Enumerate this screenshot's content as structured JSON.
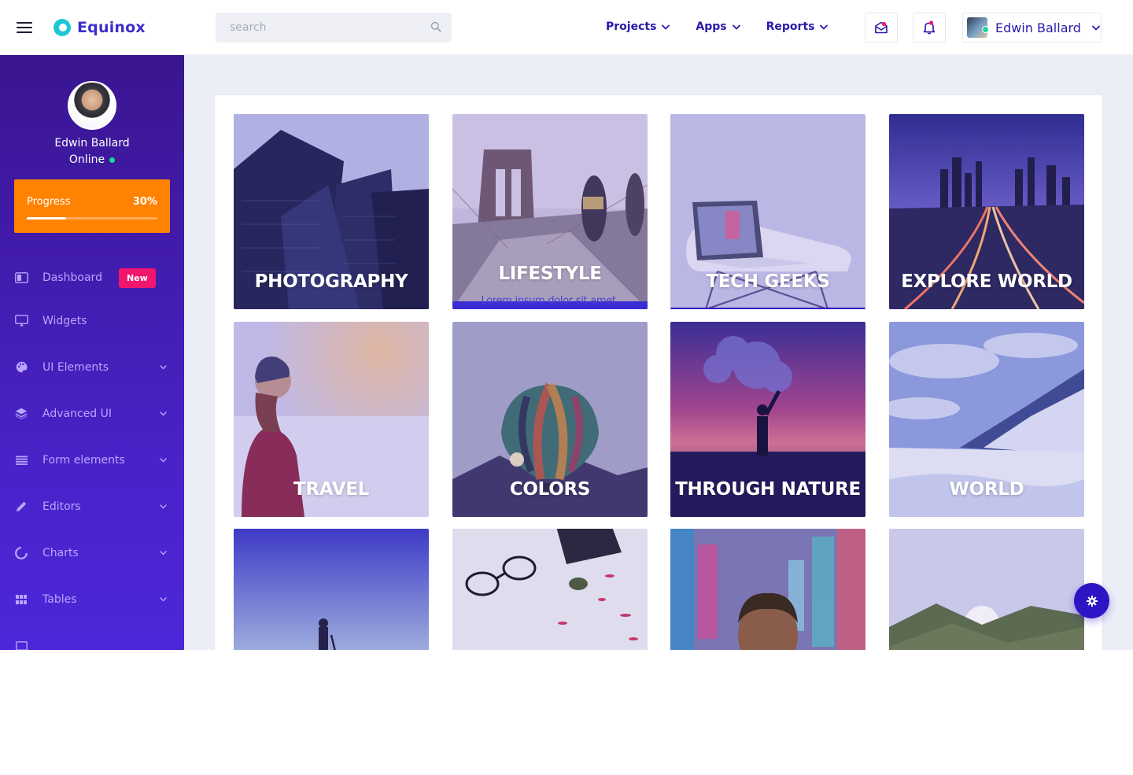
{
  "app": {
    "name": "Equinox"
  },
  "search": {
    "placeholder": "search"
  },
  "nav": {
    "items": [
      {
        "label": "Projects"
      },
      {
        "label": "Apps"
      },
      {
        "label": "Reports"
      }
    ]
  },
  "user": {
    "name": "Edwin Ballard",
    "status": "Online"
  },
  "progress": {
    "label": "Progress",
    "value_text": "30%",
    "fraction": 0.3
  },
  "sidebar": {
    "items": [
      {
        "label": "Dashboard",
        "icon": "dashboard-icon",
        "badge": "New"
      },
      {
        "label": "Widgets",
        "icon": "monitor-icon"
      },
      {
        "label": "UI Elements",
        "icon": "palette-icon"
      },
      {
        "label": "Advanced UI",
        "icon": "layers-icon"
      },
      {
        "label": "Form elements",
        "icon": "list-icon"
      },
      {
        "label": "Editors",
        "icon": "pencil-icon"
      },
      {
        "label": "Charts",
        "icon": "chart-ring-icon"
      },
      {
        "label": "Tables",
        "icon": "grid-icon"
      }
    ]
  },
  "gallery": {
    "tiles": [
      {
        "caption": "PHOTOGRAPHY"
      },
      {
        "caption": "LIFESTYLE",
        "subcaption": "Lorem ipsum dolor sit amet,"
      },
      {
        "caption": "TECH GEEKS"
      },
      {
        "caption": "EXPLORE WORLD"
      },
      {
        "caption": "TRAVEL"
      },
      {
        "caption": "COLORS"
      },
      {
        "caption": "THROUGH NATURE"
      },
      {
        "caption": "WORLD"
      },
      {
        "caption": ""
      },
      {
        "caption": ""
      },
      {
        "caption": ""
      },
      {
        "caption": ""
      }
    ]
  },
  "colors": {
    "accent": "#3d2fc9",
    "sidebar_top": "#3a1590",
    "sidebar_bottom": "#4d26d8",
    "progress_card": "#ff8200",
    "badge": "#f0166d",
    "status_online": "#1fd4a3",
    "fab": "#2d14c4"
  }
}
